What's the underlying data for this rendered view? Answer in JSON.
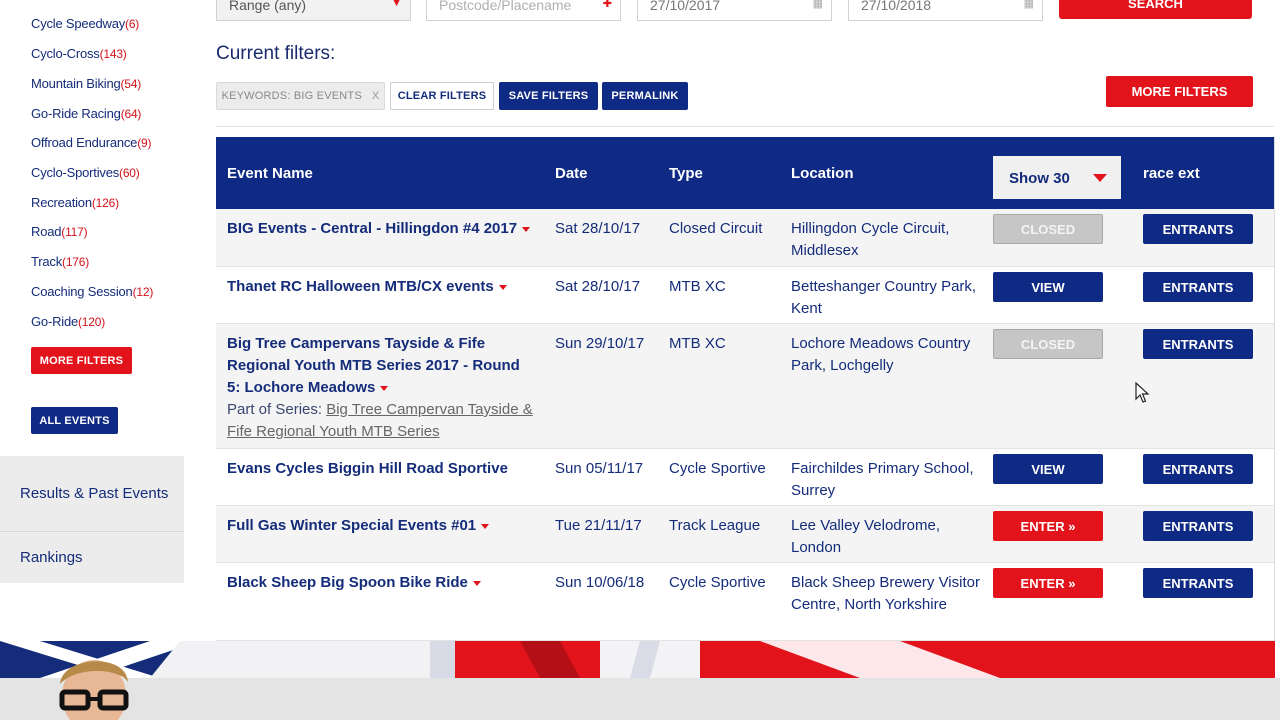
{
  "sidebar": {
    "categories": [
      {
        "label": "Cycle Speedway",
        "count": "(6)"
      },
      {
        "label": "Cyclo-Cross",
        "count": "(143)"
      },
      {
        "label": "Mountain Biking",
        "count": "(54)"
      },
      {
        "label": "Go-Ride Racing",
        "count": "(64)"
      },
      {
        "label": "Offroad Endurance",
        "count": "(9)"
      },
      {
        "label": "Cyclo-Sportives",
        "count": "(60)"
      },
      {
        "label": "Recreation",
        "count": "(126)"
      },
      {
        "label": "Road",
        "count": "(117)"
      },
      {
        "label": "Track",
        "count": "(176)"
      },
      {
        "label": "Coaching Session",
        "count": "(12)"
      },
      {
        "label": "Go-Ride",
        "count": "(120)"
      }
    ],
    "more_filters": "MORE FILTERS",
    "all_events": "ALL EVENTS",
    "results_past_events": "Results & Past Events",
    "rankings": "Rankings"
  },
  "search": {
    "range": "Range (any)",
    "postcode_placeholder": "Postcode/Placename",
    "date_from": "27/10/2017",
    "date_to": "27/10/2018",
    "search_label": "SEARCH"
  },
  "filters": {
    "title": "Current filters:",
    "keyword_chip": "KEYWORDS: BIG EVENTS",
    "chip_remove": "x",
    "clear": "CLEAR FILTERS",
    "save": "SAVE FILTERS",
    "permalink": "PERMALINK",
    "more": "MORE FILTERS"
  },
  "table": {
    "headers": {
      "event_name": "Event Name",
      "date": "Date",
      "type": "Type",
      "location": "Location",
      "show": "Show 30",
      "race_ext": "race ext"
    },
    "rows": [
      {
        "name": "BIG Events - Central - Hillingdon #4 2017",
        "date": "Sat 28/10/17",
        "type": "Closed Circuit",
        "location": "Hillingdon Cycle Circuit, Middlesex",
        "action": "CLOSED",
        "entrants": "ENTRANTS"
      },
      {
        "name": "Thanet RC Halloween MTB/CX events",
        "date": "Sat 28/10/17",
        "type": "MTB XC",
        "location": "Betteshanger Country Park, Kent",
        "action": "VIEW",
        "entrants": "ENTRANTS"
      },
      {
        "name": "Big Tree Campervans Tayside & Fife Regional Youth MTB Series 2017 - Round 5: Lochore Meadows",
        "date": "Sun 29/10/17",
        "type": "MTB XC",
        "location": "Lochore Meadows Country Park, Lochgelly",
        "action": "CLOSED",
        "entrants": "ENTRANTS",
        "series_label": "Part of Series:",
        "series_link": "Big Tree Campervan Tayside & Fife Regional Youth MTB Series"
      },
      {
        "name": "Evans Cycles Biggin Hill Road Sportive",
        "date": "Sun 05/11/17",
        "type": "Cycle Sportive",
        "location": "Fairchildes Primary School, Surrey",
        "action": "VIEW",
        "entrants": "ENTRANTS"
      },
      {
        "name": "Full Gas Winter Special Events #01",
        "date": "Tue 21/11/17",
        "type": "Track League",
        "location": "Lee Valley Velodrome, London",
        "action": "ENTER »",
        "entrants": "ENTRANTS"
      },
      {
        "name": "Black Sheep Big Spoon Bike Ride",
        "date": "Sun 10/06/18",
        "type": "Cycle Sportive",
        "location": "Black Sheep Brewery Visitor Centre, North Yorkshire",
        "action": "ENTER »",
        "entrants": "ENTRANTS"
      }
    ]
  },
  "colors": {
    "brand_blue": "#0f2a84",
    "brand_red": "#e3131b",
    "closed_grey": "#c6c6c6"
  }
}
